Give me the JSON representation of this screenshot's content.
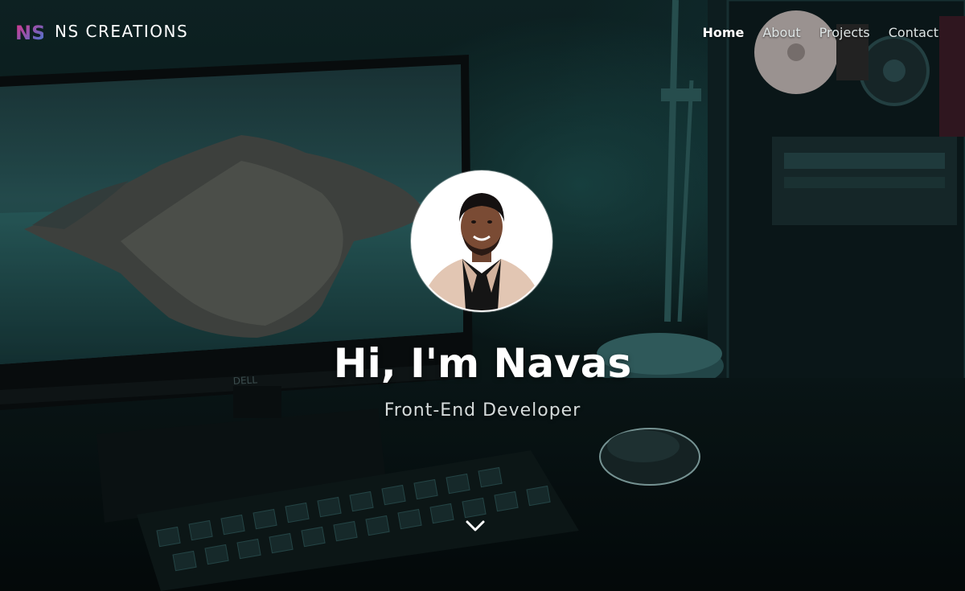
{
  "brand": {
    "logo_text": "NS",
    "name": "NS CREATIONS"
  },
  "nav": {
    "items": [
      {
        "label": "Home",
        "active": true
      },
      {
        "label": "About",
        "active": false
      },
      {
        "label": "Projects",
        "active": false
      },
      {
        "label": "Contact",
        "active": false
      }
    ]
  },
  "hero": {
    "title": "Hi, I'm Navas",
    "subtitle": "Front-End Developer",
    "avatar_icon": "profile-photo",
    "scroll_icon": "chevron-down-icon",
    "background": "desk-setup-photo"
  },
  "colors": {
    "accent_pink": "#e0338a",
    "accent_blue": "#3a7bd5",
    "text": "#ffffff"
  }
}
